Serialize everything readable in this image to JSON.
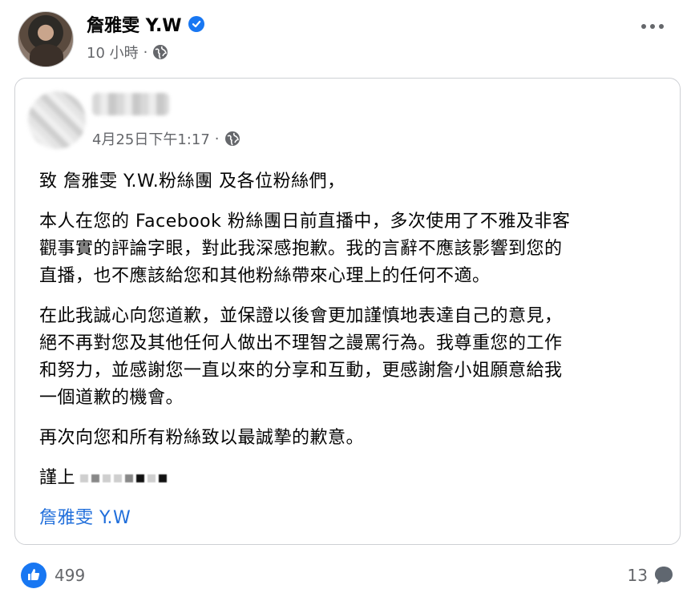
{
  "post": {
    "author_name": "詹雅雯 Y.W",
    "time_label": "10 小時",
    "separator": "·"
  },
  "shared_post": {
    "time_label": "4月25日下午1:17",
    "separator": "·",
    "greeting": "致  詹雅雯 Y.W.粉絲團 及各位粉絲們，",
    "paragraph_1": [
      "本人在您的 Facebook 粉絲團日前直播中，多次使用了不雅及非客",
      "觀事實的評論字眼，對此我深感抱歉。我的言辭不應該影響到您的",
      "直播，也不應該給您和其他粉絲帶來心理上的任何不適。"
    ],
    "paragraph_2": [
      "在此我誠心向您道歉，並保證以後會更加謹慎地表達自己的意見，",
      "絕不再對您及其他任何人做出不理智之謾罵行為。我尊重您的工作",
      "和努力，並感謝您一直以來的分享和互動，更感謝詹小姐願意給我",
      "一個道歉的機會。"
    ],
    "paragraph_3": "再次向您和所有粉絲致以最誠摯的歉意。",
    "sign_off": "謹上",
    "tagged_name": "詹雅雯 Y.W"
  },
  "footer": {
    "reaction_count": "499",
    "comment_count": "13"
  },
  "colors": {
    "brand_blue": "#1877f2",
    "link_blue": "#216fdb",
    "meta_gray": "#65676b"
  },
  "icons": [
    "verified-badge-icon",
    "globe-icon",
    "more-options-icon",
    "like-icon",
    "comment-icon"
  ]
}
